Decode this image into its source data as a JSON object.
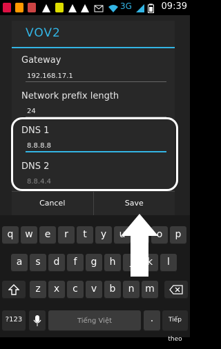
{
  "status_bar": {
    "network": "3G",
    "time": "09:39"
  },
  "dialog": {
    "title": "VOV2",
    "fields": [
      {
        "label": "Gateway",
        "value": "192.168.17.1"
      },
      {
        "label": "Network prefix length",
        "value": "24"
      },
      {
        "label": "DNS 1",
        "value": "8.8.8.8"
      },
      {
        "label": "DNS 2",
        "value": "8.8.4.4"
      }
    ],
    "buttons": {
      "cancel": "Cancel",
      "save": "Save"
    }
  },
  "keyboard": {
    "row1": [
      "q",
      "w",
      "e",
      "r",
      "t",
      "y",
      "u",
      "i",
      "o",
      "p"
    ],
    "row2": [
      "a",
      "s",
      "d",
      "f",
      "g",
      "h",
      "j",
      "k",
      "l"
    ],
    "row3": [
      "z",
      "x",
      "c",
      "v",
      "b",
      "n",
      "m"
    ],
    "symbols": "?123",
    "space": "Tiếng Việt",
    "period": ".",
    "next": "Tiếp theo"
  },
  "colors": {
    "accent": "#33b5e5"
  }
}
